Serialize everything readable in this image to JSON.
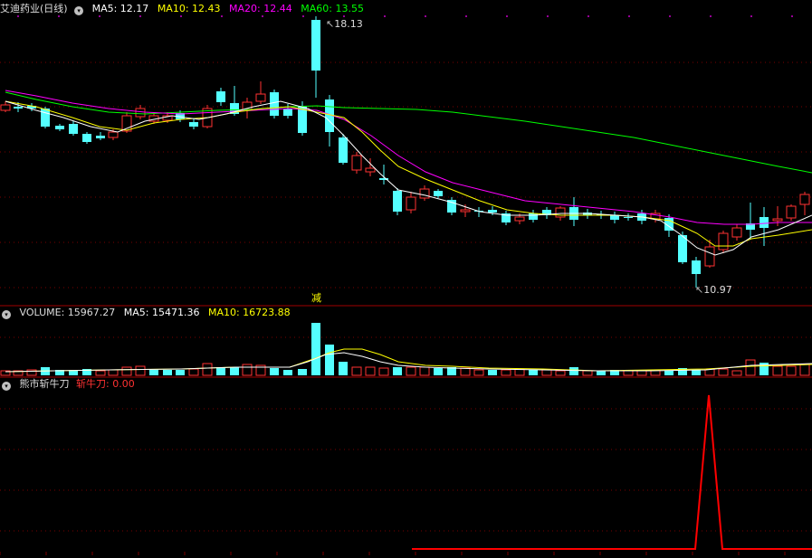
{
  "price": {
    "title": "艾迪药业(日线)",
    "ma": [
      {
        "label": "MA5: 12.17",
        "color": "#ffffff"
      },
      {
        "label": "MA10: 12.43",
        "color": "#ffff00"
      },
      {
        "label": "MA20: 12.44",
        "color": "#ff00ff"
      },
      {
        "label": "MA60: 13.55",
        "color": "#00ff00"
      }
    ],
    "high_label": "18.13",
    "low_label": "10.97",
    "signal_label": "减"
  },
  "volume": {
    "label": "VOLUME: 15967.27",
    "ma5": "MA5: 15471.36",
    "ma10": "MA10: 16723.88"
  },
  "indicator": {
    "name": "熊市斩牛刀",
    "value_label": "斩牛刀: 0.00"
  },
  "colors": {
    "up": "#ff3232",
    "down": "#54ffff",
    "ma5": "#ffffff",
    "ma10": "#ffff00",
    "ma20": "#ff00ff",
    "ma60": "#00ff00",
    "grid": "#7a0000",
    "indicator_line": "#ff0000"
  }
}
